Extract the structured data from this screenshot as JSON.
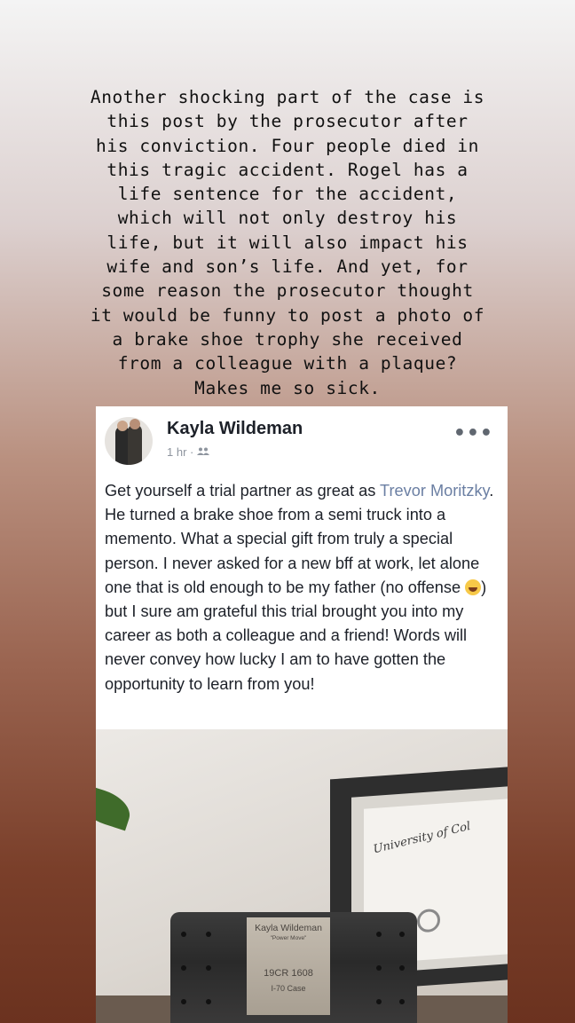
{
  "caption": "Another shocking part of the case is\nthis post by the prosecutor after\nhis conviction. Four people died in\nthis tragic accident. Rogel has a\nlife sentence for the accident,\nwhich will not only destroy his\nlife, but it will also impact his\nwife and son’s life. And yet, for\nsome reason the prosecutor thought\nit would be funny to post a photo of\na brake shoe trophy she received\nfrom a colleague with a plaque?\nMakes me so sick.",
  "post": {
    "author": "Kayla Wildeman",
    "time": "1 hr · ",
    "audience_icon": "friends-icon",
    "more_label": "•••",
    "text_before": "Get yourself a trial partner as great as ",
    "tagged": "Trevor Moritzky",
    "text_middle": ". He turned a brake shoe from a semi truck into a memento. What a special gift from truly a special person. I never asked for a new bff at work, let alone one that is old enough to be my father (no offense ",
    "emoji": "grinning-squinting-face-emoji",
    "text_after": ") but I sure am grateful this trial brought you into my career as both a colleague and a friend! Words will never convey how lucky I am to have gotten the opportunity to learn from you!"
  },
  "photo": {
    "plaque_name": "Kayla Wildeman",
    "plaque_subtitle": "\"Power Move\"",
    "plaque_case": "19CR 1608",
    "plaque_route": "I-70 Case",
    "diploma_text": "University of Col"
  },
  "colors": {
    "tag_link": "#6b7fa3",
    "author_text": "#1d2129",
    "meta_text": "#8d949e"
  }
}
